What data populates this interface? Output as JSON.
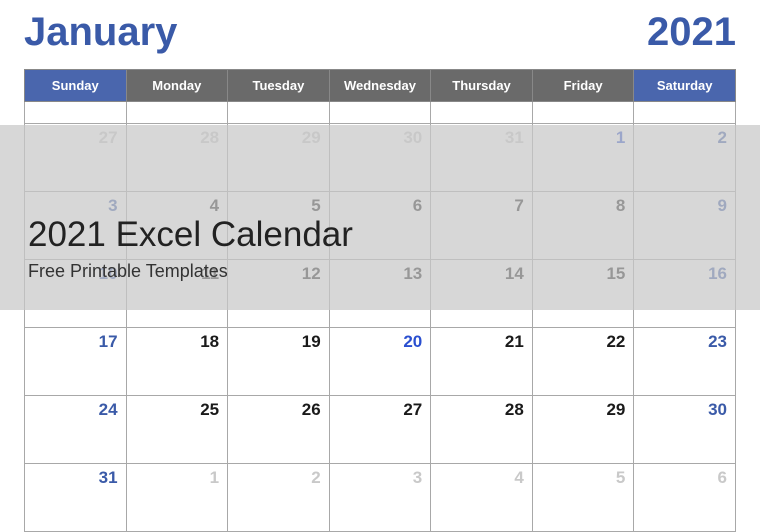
{
  "header": {
    "month": "January",
    "year": "2021"
  },
  "weekdays": [
    {
      "label": "Sunday",
      "class": "weekend"
    },
    {
      "label": "Monday",
      "class": "weekday"
    },
    {
      "label": "Tuesday",
      "class": "weekday"
    },
    {
      "label": "Wednesday",
      "class": "weekday"
    },
    {
      "label": "Thursday",
      "class": "weekday"
    },
    {
      "label": "Friday",
      "class": "weekday"
    },
    {
      "label": "Saturday",
      "class": "weekend"
    }
  ],
  "weeks": [
    {
      "row": "short",
      "days": [
        {
          "n": "",
          "cls": "prev"
        },
        {
          "n": "",
          "cls": "prev"
        },
        {
          "n": "",
          "cls": "prev"
        },
        {
          "n": "",
          "cls": "prev"
        },
        {
          "n": "",
          "cls": "prev"
        },
        {
          "n": "",
          "cls": "prev"
        },
        {
          "n": "",
          "cls": "prev"
        }
      ]
    },
    {
      "row": "tall",
      "days": [
        {
          "n": "27",
          "cls": "prev"
        },
        {
          "n": "28",
          "cls": "prev"
        },
        {
          "n": "29",
          "cls": "prev"
        },
        {
          "n": "30",
          "cls": "prev"
        },
        {
          "n": "31",
          "cls": "prev"
        },
        {
          "n": "1",
          "cls": "holiday"
        },
        {
          "n": "2",
          "cls": "weekend-day"
        }
      ]
    },
    {
      "row": "tall",
      "days": [
        {
          "n": "3",
          "cls": "weekend-day"
        },
        {
          "n": "4",
          "cls": "current"
        },
        {
          "n": "5",
          "cls": "current"
        },
        {
          "n": "6",
          "cls": "current"
        },
        {
          "n": "7",
          "cls": "current"
        },
        {
          "n": "8",
          "cls": "current"
        },
        {
          "n": "9",
          "cls": "weekend-day"
        }
      ]
    },
    {
      "row": "tall",
      "days": [
        {
          "n": "10",
          "cls": "weekend-day"
        },
        {
          "n": "11",
          "cls": "current"
        },
        {
          "n": "12",
          "cls": "current"
        },
        {
          "n": "13",
          "cls": "current"
        },
        {
          "n": "14",
          "cls": "current"
        },
        {
          "n": "15",
          "cls": "current"
        },
        {
          "n": "16",
          "cls": "weekend-day"
        }
      ]
    },
    {
      "row": "tall",
      "days": [
        {
          "n": "17",
          "cls": "weekend-day"
        },
        {
          "n": "18",
          "cls": "current"
        },
        {
          "n": "19",
          "cls": "current"
        },
        {
          "n": "20",
          "cls": "holiday"
        },
        {
          "n": "21",
          "cls": "current"
        },
        {
          "n": "22",
          "cls": "current"
        },
        {
          "n": "23",
          "cls": "weekend-day"
        }
      ]
    },
    {
      "row": "tall",
      "days": [
        {
          "n": "24",
          "cls": "weekend-day"
        },
        {
          "n": "25",
          "cls": "current"
        },
        {
          "n": "26",
          "cls": "current"
        },
        {
          "n": "27",
          "cls": "current"
        },
        {
          "n": "28",
          "cls": "current"
        },
        {
          "n": "29",
          "cls": "current"
        },
        {
          "n": "30",
          "cls": "weekend-day"
        }
      ]
    },
    {
      "row": "tall",
      "days": [
        {
          "n": "31",
          "cls": "weekend-day"
        },
        {
          "n": "1",
          "cls": "next"
        },
        {
          "n": "2",
          "cls": "next"
        },
        {
          "n": "3",
          "cls": "next"
        },
        {
          "n": "4",
          "cls": "next"
        },
        {
          "n": "5",
          "cls": "next"
        },
        {
          "n": "6",
          "cls": "next"
        }
      ]
    }
  ],
  "overlay": {
    "title": "2021 Excel Calendar",
    "subtitle": "Free Printable Templates"
  }
}
